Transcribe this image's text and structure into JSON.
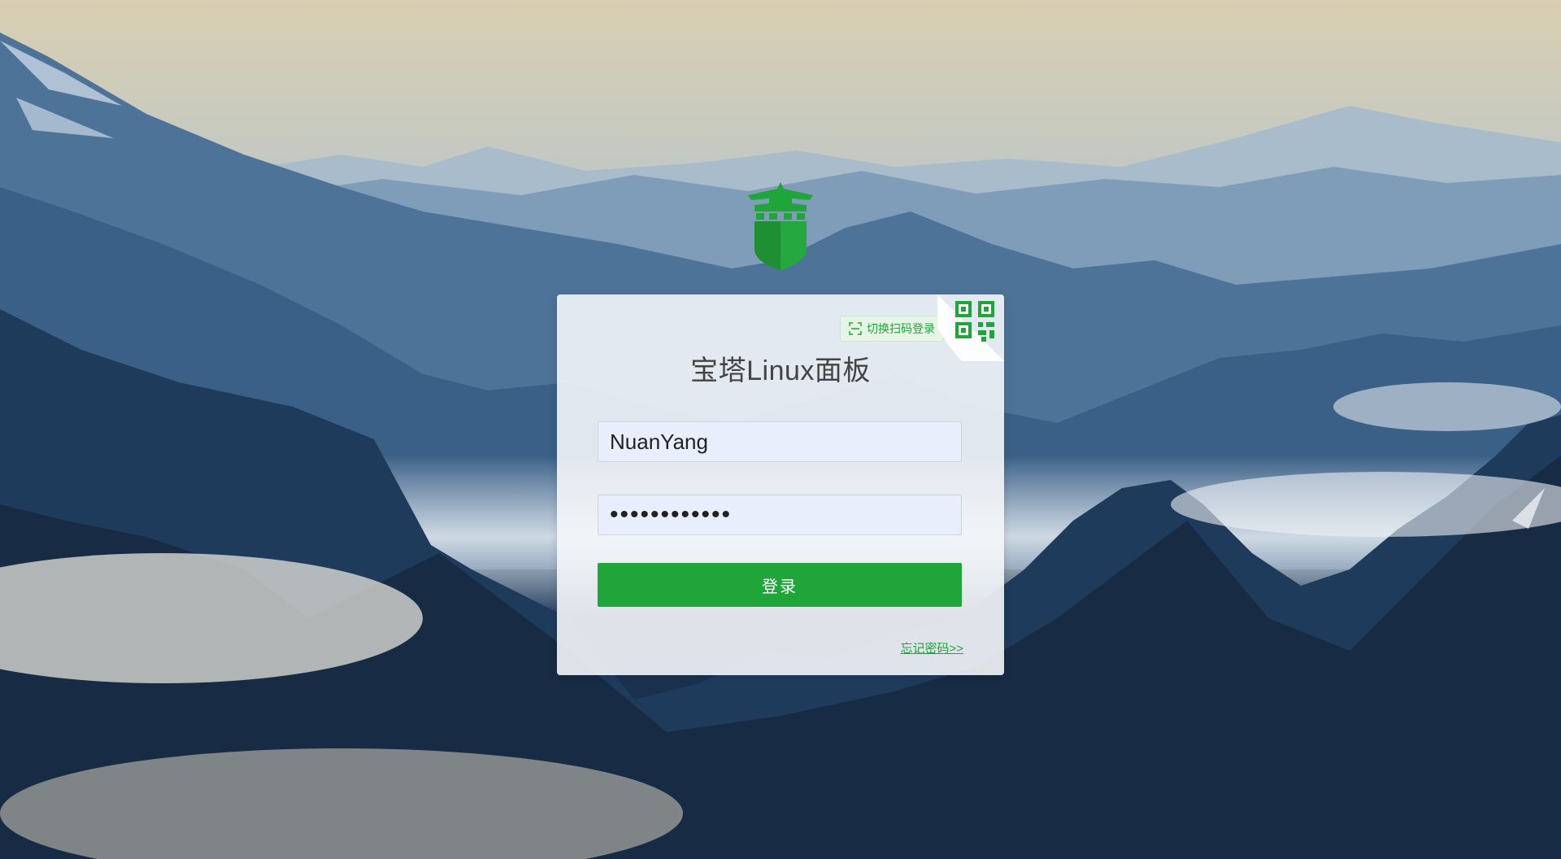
{
  "page": {
    "title": "宝塔Linux面板"
  },
  "login": {
    "username_value": "NuanYang",
    "password_value": "••••••••••••",
    "login_label": "登录",
    "forgot_label": "忘记密码>>",
    "qr_switch_label": "切换扫码登录"
  },
  "icons": {
    "logo": "baota-shield-logo-icon",
    "qr": "qrcode-icon",
    "scan": "scan-icon"
  },
  "colors": {
    "accent": "#20a53a",
    "card_bg": "#f4f6fa",
    "input_bg": "#e8eefb"
  }
}
